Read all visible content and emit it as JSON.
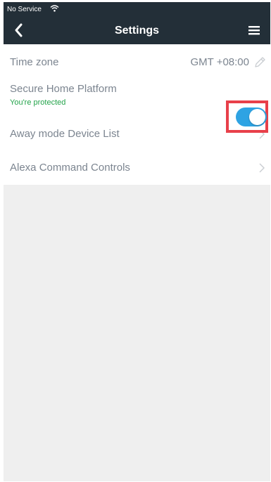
{
  "status_bar": {
    "carrier": "No Service"
  },
  "header": {
    "title": "Settings"
  },
  "settings": {
    "timezone": {
      "label": "Time zone",
      "value": "GMT +08:00"
    },
    "secure_home": {
      "label": "Secure Home Platform",
      "status": "You're protected",
      "enabled": true
    },
    "away_mode": {
      "label": "Away mode Device List"
    },
    "alexa": {
      "label": "Alexa Command Controls"
    }
  },
  "colors": {
    "topbar": "#232f38",
    "toggle_on": "#2ea3e3",
    "status_ok": "#23a34a",
    "highlight": "#e8404a"
  },
  "icons": [
    "wifi-icon",
    "back-arrow-icon",
    "hamburger-menu-icon",
    "pencil-icon",
    "chevron-right-icon"
  ]
}
